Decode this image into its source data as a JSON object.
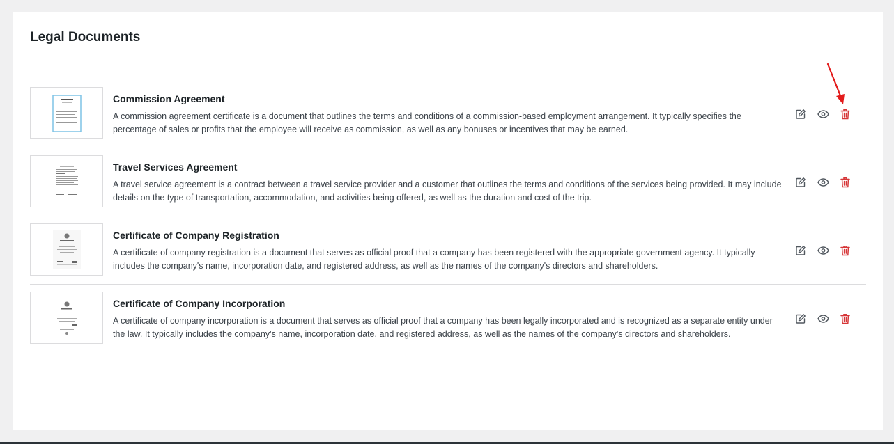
{
  "page": {
    "title": "Legal Documents"
  },
  "documents": [
    {
      "title": "Commission Agreement",
      "description": "A commission agreement certificate is a document that outlines the terms and conditions of a commission-based employment arrangement. It typically specifies the percentage of sales or profits that the employee will receive as commission, as well as any bonuses or incentives that may be earned."
    },
    {
      "title": "Travel Services Agreement",
      "description": "A travel service agreement is a contract between a travel service provider and a customer that outlines the terms and conditions of the services being provided. It may include details on the type of transportation, accommodation, and activities being offered, as well as the duration and cost of the trip."
    },
    {
      "title": "Certificate of Company Registration",
      "description": "A certificate of company registration is a document that serves as official proof that a company has been registered with the appropriate government agency. It typically includes the company's name, incorporation date, and registered address, as well as the names of the company's directors and shareholders."
    },
    {
      "title": "Certificate of Company Incorporation",
      "description": "A certificate of company incorporation is a document that serves as official proof that a company has been legally incorporated and is recognized as a separate entity under the law. It typically includes the company's name, incorporation date, and registered address, as well as the names of the company's directors and shareholders."
    }
  ],
  "icons": {
    "edit": "edit-icon",
    "view": "eye-icon",
    "delete": "trash-icon",
    "annotation": "red-arrow"
  },
  "colors": {
    "icon_gray": "#50575e",
    "delete_red": "#d63638",
    "annotation_red": "#e31b1b"
  }
}
